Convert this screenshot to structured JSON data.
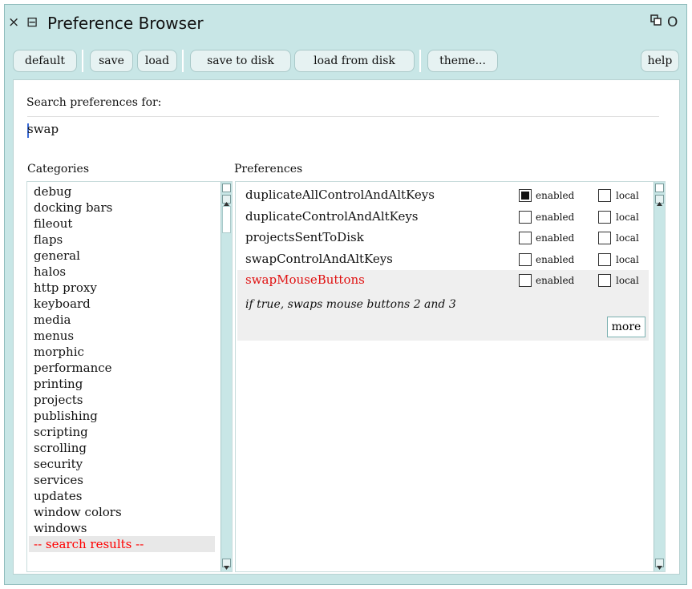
{
  "window": {
    "title": "Preference Browser",
    "close_glyph": "×",
    "menu_glyph": "⊟",
    "collapse_glyph": "ꟷ",
    "expand_glyph": "O"
  },
  "toolbar": {
    "buttons": [
      "default",
      "save",
      "load",
      "save to disk",
      "load from disk",
      "theme...",
      "help"
    ]
  },
  "search": {
    "label": "Search preferences for:",
    "value": "swap"
  },
  "categories": {
    "header": "Categories",
    "items": [
      "debug",
      "docking bars",
      "fileout",
      "flaps",
      "general",
      "halos",
      "http proxy",
      "keyboard",
      "media",
      "menus",
      "morphic",
      "performance",
      "printing",
      "projects",
      "publishing",
      "scripting",
      "scrolling",
      "security",
      "services",
      "updates",
      "window colors",
      "windows",
      "-- search results --"
    ],
    "selected_index": 22,
    "selected_color": "#ff0000"
  },
  "preferences": {
    "header": "Preferences",
    "rows": [
      {
        "name": "duplicateAllControlAndAltKeys",
        "enabled": true,
        "local": false
      },
      {
        "name": "duplicateControlAndAltKeys",
        "enabled": false,
        "local": false
      },
      {
        "name": "projectsSentToDisk",
        "enabled": false,
        "local": false
      },
      {
        "name": "swapControlAndAltKeys",
        "enabled": false,
        "local": false
      },
      {
        "name": "swapMouseButtons",
        "enabled": false,
        "local": false,
        "highlight_color": "#e01010"
      }
    ],
    "enabled_label": "enabled",
    "local_label": "local",
    "selected_help": "if true, swaps mouse buttons 2 and 3",
    "more_label": "more"
  },
  "colors": {
    "window_bg": "#c8e6e6",
    "button_bg": "#e6f2f2"
  }
}
